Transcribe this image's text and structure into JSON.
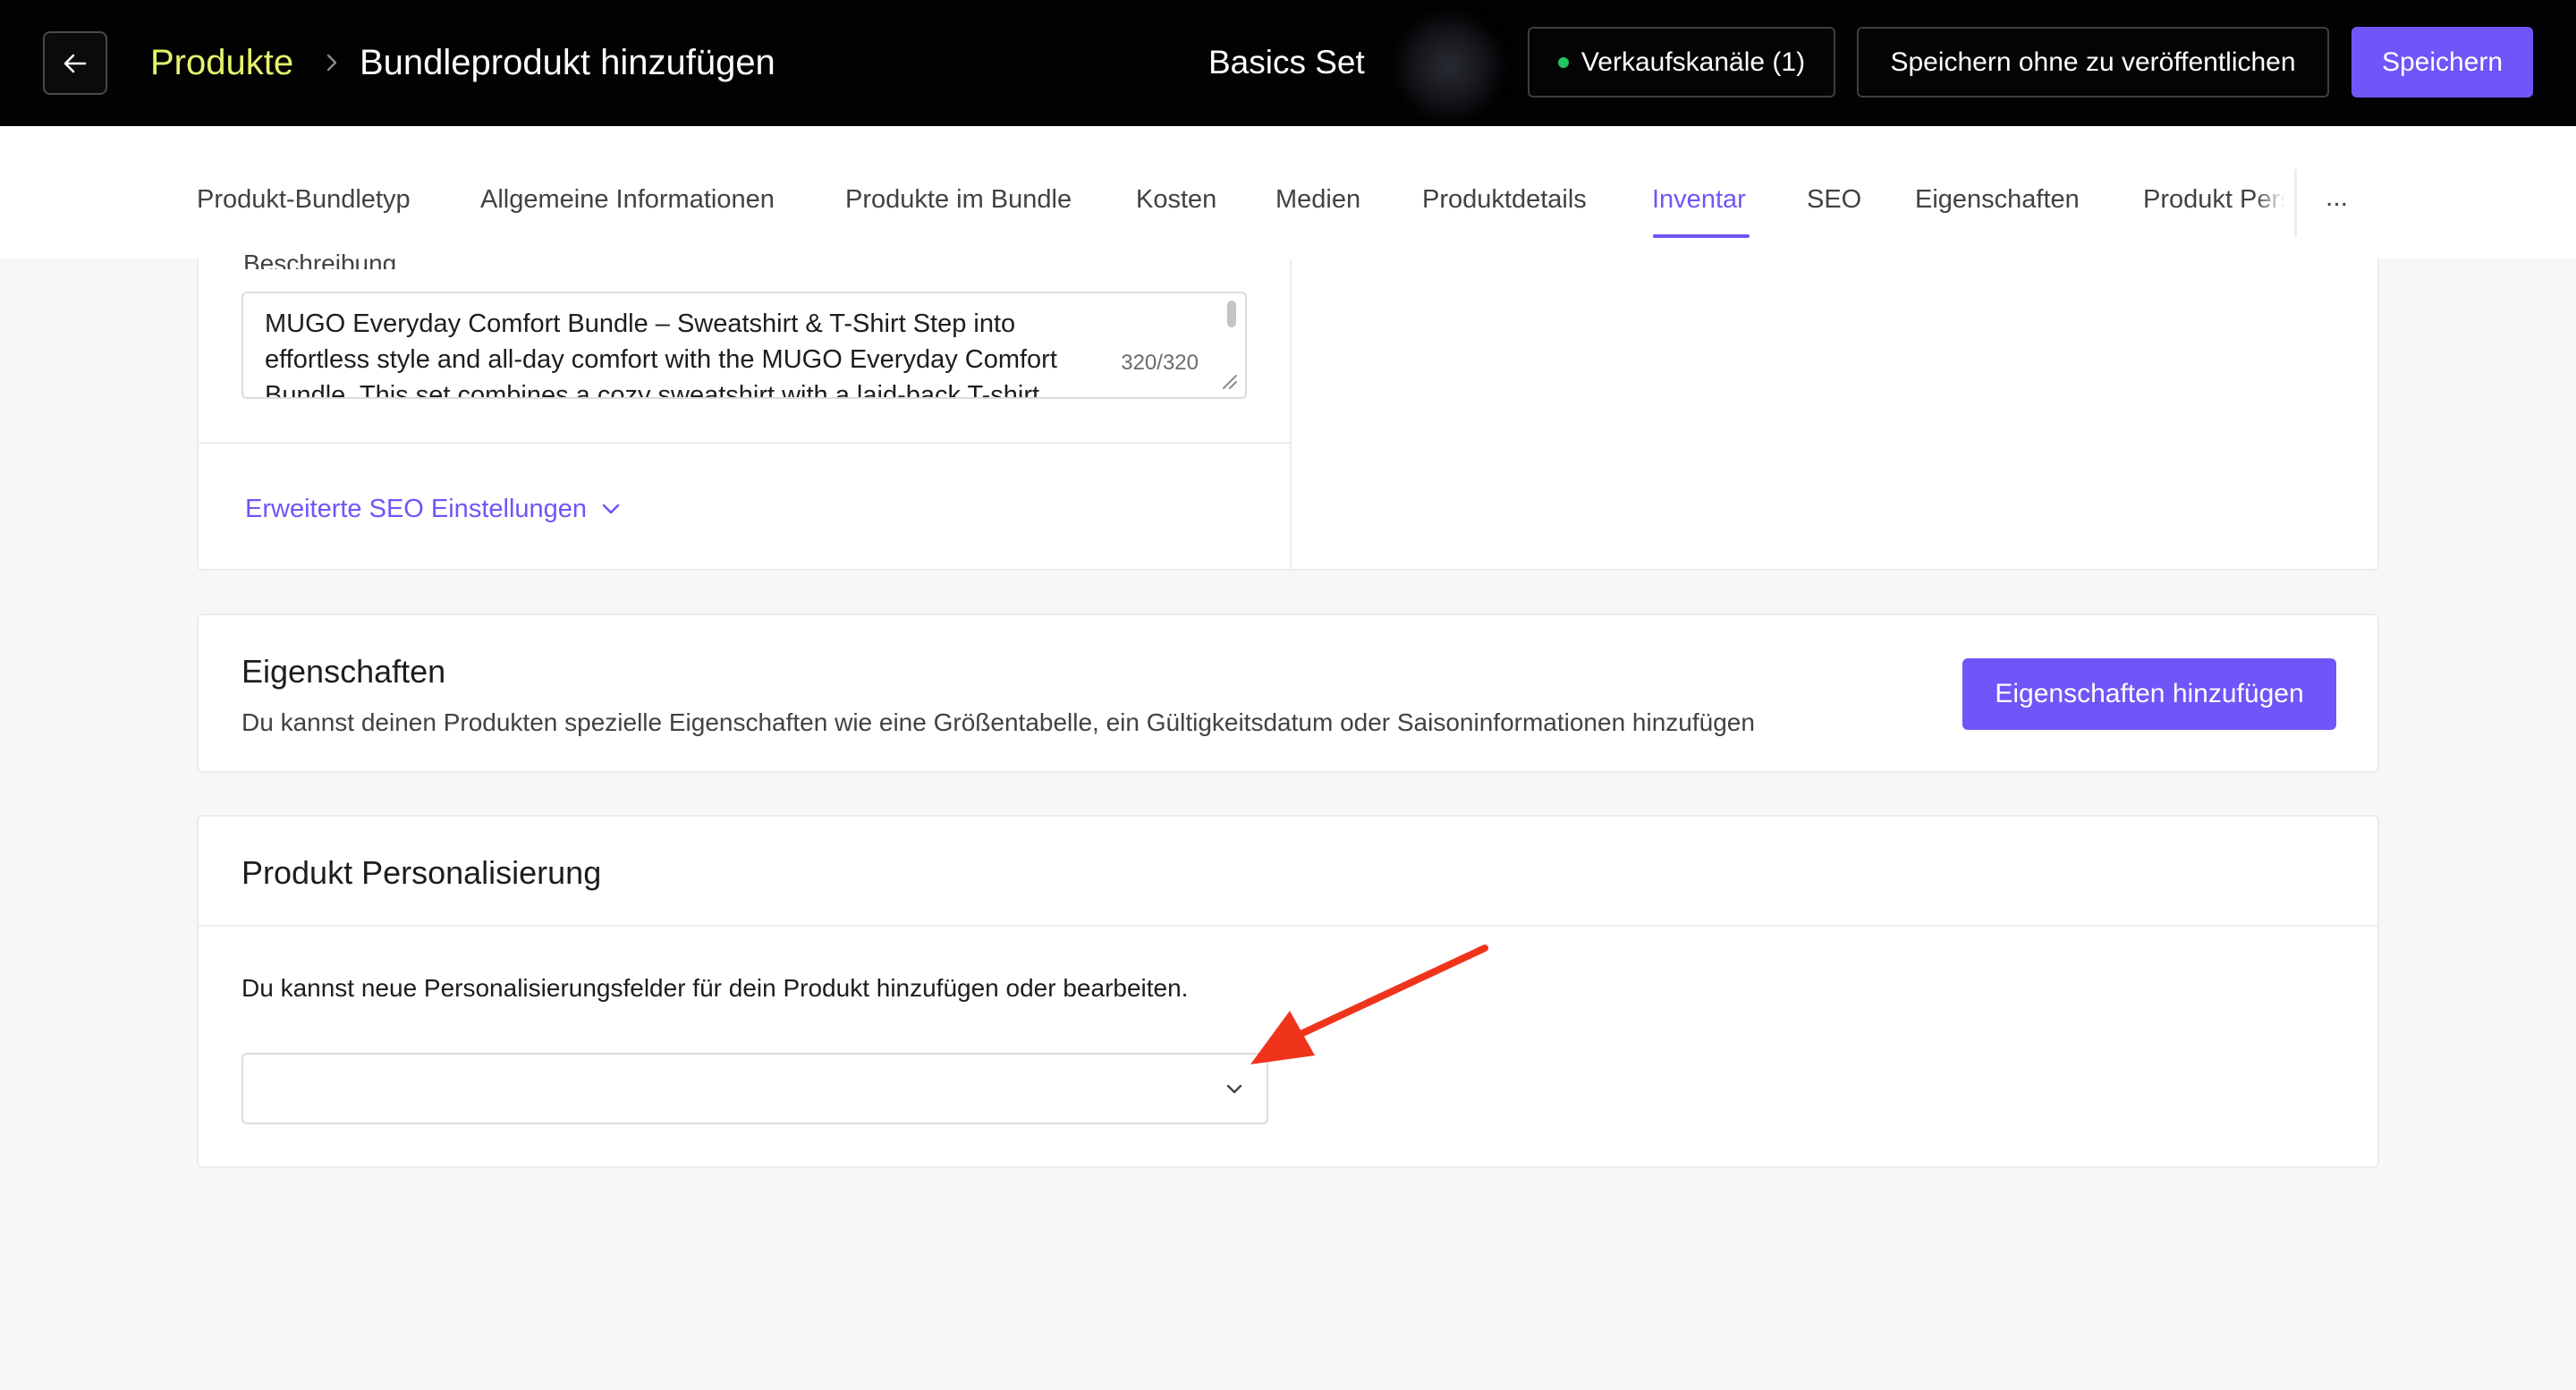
{
  "header": {
    "breadcrumb_parent": "Produkte",
    "breadcrumb_current": "Bundleprodukt hinzufügen",
    "product_name": "Basics Set",
    "sales_channels_label": "Verkaufskanäle (1)",
    "save_draft_label": "Speichern ohne zu veröffentlichen",
    "save_label": "Speichern"
  },
  "tabs": [
    {
      "label": "Produkt-Bundletyp"
    },
    {
      "label": "Allgemeine Informationen"
    },
    {
      "label": "Produkte im Bundle"
    },
    {
      "label": "Kosten"
    },
    {
      "label": "Medien"
    },
    {
      "label": "Produktdetails"
    },
    {
      "label": "Inventar",
      "active": true
    },
    {
      "label": "SEO"
    },
    {
      "label": "Eigenschaften"
    },
    {
      "label": "Produkt Pers"
    }
  ],
  "tabs_more": "...",
  "seo": {
    "description_label": "Beschreibung",
    "description_value": "MUGO Everyday Comfort Bundle – Sweatshirt & T-Shirt Step into effortless style and all-day comfort with the MUGO Everyday Comfort Bundle. This set combines a cozy sweatshirt with a laid-back T-shirt",
    "char_count": "320/320",
    "advanced_label": "Erweiterte SEO Einstellungen"
  },
  "properties": {
    "title": "Eigenschaften",
    "description": "Du kannst deinen Produkten spezielle Eigenschaften wie eine Größentabelle, ein Gültigkeitsdatum oder Saisoninformationen hinzufügen",
    "add_button": "Eigenschaften hinzufügen"
  },
  "personalization": {
    "title": "Produkt Personalisierung",
    "description": "Du kannst neue Personalisierungsfelder für dein Produkt hinzufügen oder bearbeiten.",
    "select_value": ""
  },
  "colors": {
    "accent": "#6e56f8",
    "breadcrumb": "#e4f36e",
    "status_dot": "#22c55e",
    "annotation_arrow": "#f0341c"
  },
  "icons": [
    "arrow-left-icon",
    "chevron-right-icon",
    "chevron-down-icon",
    "status-dot-icon",
    "annotation-arrow"
  ]
}
